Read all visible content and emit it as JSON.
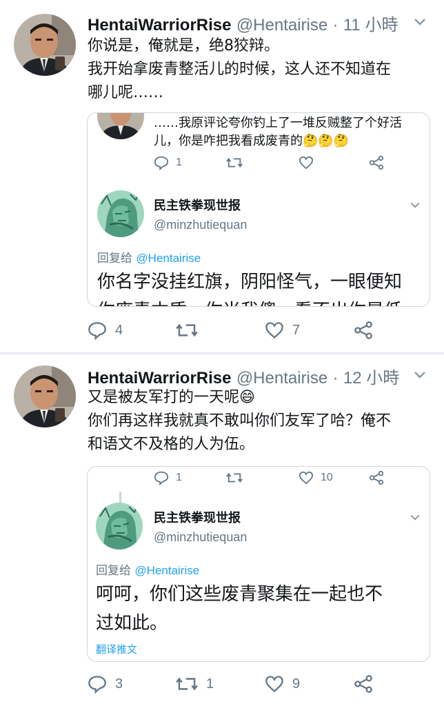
{
  "tweets": [
    {
      "author_name": "HentaiWarriorRise",
      "author_handle": "@Hentairise",
      "separator": "·",
      "time": "11 小時",
      "text_lines": [
        "你说是，俺就是，绝8狡辩。",
        "我开始拿废青整活儿的时候，这人还不知道在",
        "哪儿呢……"
      ],
      "quote": {
        "prev_text_lines": [
          "……我原评论夸你钓上了一堆反贼整了个好活",
          "儿，你是咋把我看成废青的🤔🤔🤔"
        ],
        "prev_actions": {
          "reply_count": "1",
          "retweet_count": "",
          "like_count": ""
        },
        "author_name": "民主铁拳现世报",
        "author_handle": "@minzhutiequan",
        "reply_prefix": "回复给",
        "reply_to": "@Hentairise",
        "text_lines": [
          "你名字没挂红旗，阴阳怪气，一眼便知",
          "你废青本质，你当我傻，看不出你是低"
        ]
      },
      "actions": {
        "reply_count": "4",
        "retweet_count": "",
        "like_count": "7"
      }
    },
    {
      "author_name": "HentaiWarriorRise",
      "author_handle": "@Hentairise",
      "separator": "·",
      "time": "12 小時",
      "text_lines": [
        "又是被友军打的一天呢😄",
        "你们再这样我就真不敢叫你们友军了哈？俺不",
        "和语文不及格的人为伍。"
      ],
      "quote": {
        "prev_actions": {
          "reply_count": "1",
          "retweet_count": "",
          "like_count": "10"
        },
        "author_name": "民主铁拳现世报",
        "author_handle": "@minzhutiequan",
        "reply_prefix": "回复给",
        "reply_to": "@Hentairise",
        "text_lines": [
          "呵呵，你们这些废青聚集在一起也不",
          "过如此。"
        ],
        "translate_label": "翻译推文"
      },
      "actions": {
        "reply_count": "3",
        "retweet_count": "1",
        "like_count": "9"
      }
    }
  ],
  "icons": {
    "reply": "reply-icon",
    "retweet": "retweet-icon",
    "like": "heart-icon",
    "share": "share-icon",
    "caret": "chevron-down-icon"
  },
  "colors": {
    "text": "#14171a",
    "secondary": "#657786",
    "link": "#1da1f2",
    "border": "#ccd6dd",
    "divider": "#e6ecf0"
  }
}
